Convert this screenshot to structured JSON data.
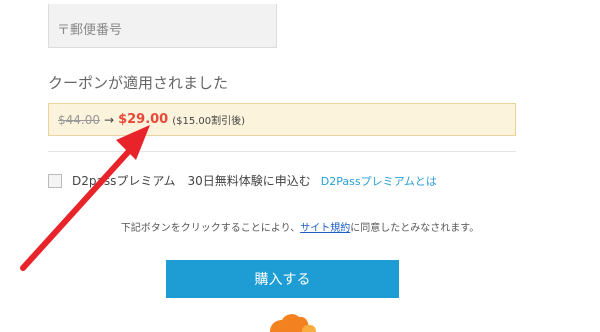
{
  "form": {
    "postal_placeholder": "〒郵便番号"
  },
  "coupon": {
    "heading": "クーポンが適用されました",
    "old_price": "$44.00",
    "arrow": "→",
    "new_price": "$29.00",
    "discount_note": "($15.00割引後)"
  },
  "trial": {
    "label": "D2passプレミアム　30日無料体験に申込む",
    "link_label": "D2Passプレミアムとは"
  },
  "terms": {
    "before": "下記ボタンをクリックすることにより、",
    "link": "サイト規約",
    "after": "に同意したとみなされます。"
  },
  "buy_button_label": "購入する",
  "icons": {
    "annotation": "red-arrow-icon",
    "logo": "cloudflare-logo-icon"
  },
  "colors": {
    "accent": "#1e9dd4",
    "price_red": "#e54a3a",
    "coupon_bg": "#fbf3dc",
    "annotation_red": "#e8242a"
  }
}
